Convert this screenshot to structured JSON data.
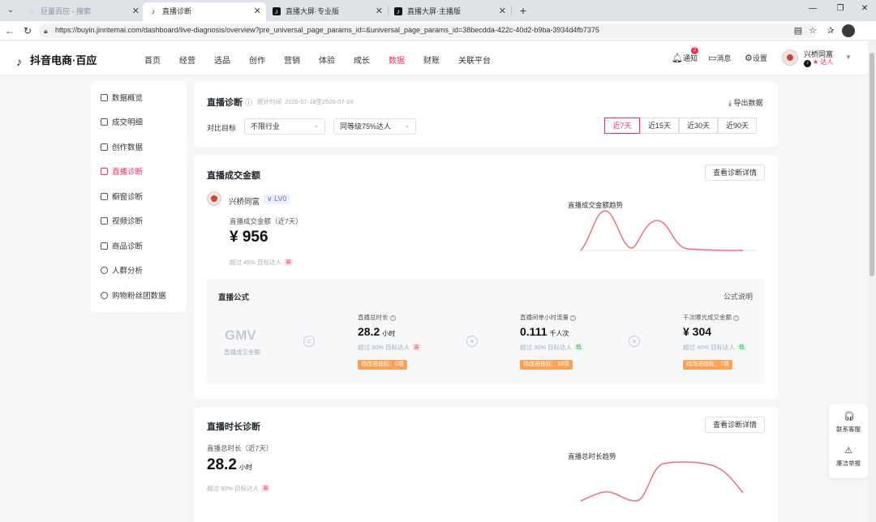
{
  "browser": {
    "tabs": [
      {
        "title": "巨量百应 - 搜索",
        "active": false
      },
      {
        "title": "直播诊断",
        "active": true
      },
      {
        "title": "直播大屏·专业版",
        "active": false
      },
      {
        "title": "直播大屏·主播版",
        "active": false
      }
    ],
    "url": "https://buyin.jinritemai.com/dashboard/live-diagnosis/overview?pre_universal_page_params_id=&universal_page_params_id=38becdda-422c-40d2-b9ba-3934d4fb7375"
  },
  "header": {
    "logo": "抖音电商·百应",
    "nav": [
      "首页",
      "经营",
      "选品",
      "创作",
      "营销",
      "体验",
      "成长",
      "数据",
      "财账",
      "关联平台"
    ],
    "active_nav": "数据",
    "notify_label": "通知",
    "notify_count": "2",
    "message_label": "消息",
    "settings_label": "设置",
    "user_name": "兴桥同富",
    "user_role": "达人"
  },
  "sidebar": {
    "items": [
      "数据概览",
      "成交明细",
      "创作数据",
      "直播诊断",
      "橱窗诊断",
      "视频诊断",
      "商品诊断",
      "人群分析",
      "购物粉丝团数据"
    ],
    "active": "直播诊断"
  },
  "filter_card": {
    "title": "直播诊断",
    "stat_time": "统计时间: 2026-07-18至2026-07-24",
    "export_label": "导出数据",
    "compare_label": "对比目标",
    "industry_select": "不限行业",
    "level_select": "同等级75%达人",
    "ranges": [
      "近7天",
      "近15天",
      "近30天",
      "近90天"
    ],
    "active_range": "近7天"
  },
  "gmv_card": {
    "title": "直播成交金额",
    "detail_button": "查看诊断详情",
    "account_name": "兴桥同富",
    "level": "LV0",
    "metric_label": "直播成交金额（近7天）",
    "metric_value": "¥ 956",
    "compare_text": "超过 45% 目标达人",
    "compare_tag": "高",
    "chart_title": "直播成交金额趋势",
    "formula_title": "直播公式",
    "formula_help": "公式说明",
    "gmv_word": "GMV",
    "gmv_sub": "直播成交金额",
    "metrics": [
      {
        "label": "直播总时长",
        "value": "28.2",
        "unit": "小时",
        "sub": "超过 90% 目标达人",
        "tag": "高",
        "tag_type": "high",
        "improve": "待改进指标：0项"
      },
      {
        "label": "直播间单小时流量",
        "value": "0.111",
        "unit": "千人次",
        "sub": "超过 30% 目标达人",
        "tag": "低",
        "tag_type": "low",
        "improve": "待改进指标：19项"
      },
      {
        "label": "千次曝光成交金额",
        "value": "¥ 304",
        "unit": "",
        "sub": "超过 40% 目标达人",
        "tag": "低",
        "tag_type": "low",
        "improve": "待改进指标：7项"
      }
    ]
  },
  "duration_card": {
    "title": "直播时长诊断",
    "detail_button": "查看诊断详情",
    "metric_label": "直播总时长（近7天）",
    "metric_value": "28.2",
    "metric_unit": "小时",
    "compare_text": "超过 90% 目标达人",
    "compare_tag": "高",
    "chart_title": "直播总时长趋势"
  },
  "dock": {
    "service": "联系客服",
    "report": "廉洁举报"
  },
  "colors": {
    "accent": "#fe2c55",
    "chart_line": "#e8737f",
    "improve_tag": "#f7a255"
  }
}
